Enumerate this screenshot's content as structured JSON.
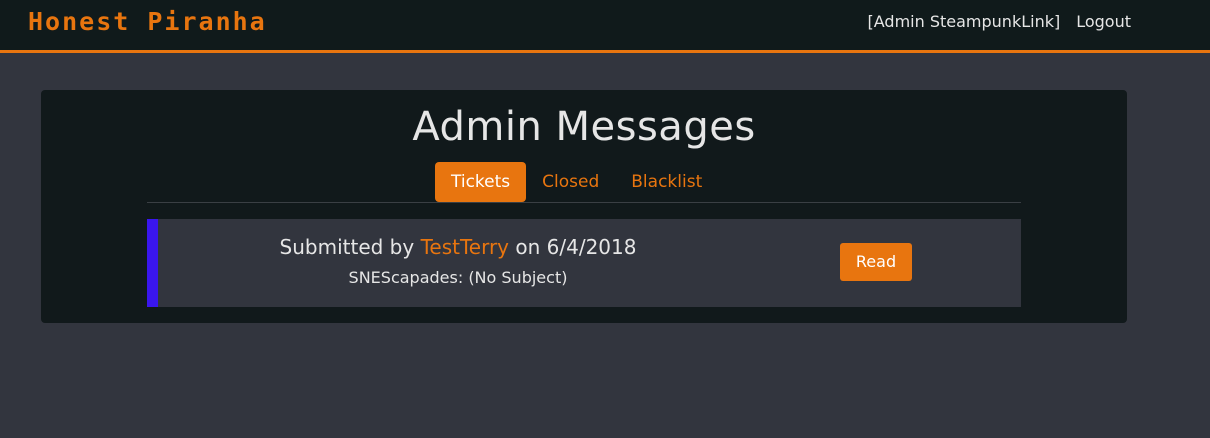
{
  "navbar": {
    "brand": "Honest Piranha",
    "user_label": "[Admin SteampunkLink]",
    "logout_label": "Logout"
  },
  "main": {
    "title": "Admin Messages",
    "tabs": [
      {
        "label": "Tickets",
        "active": true
      },
      {
        "label": "Closed",
        "active": false
      },
      {
        "label": "Blacklist",
        "active": false
      }
    ],
    "tickets": [
      {
        "prefix": "Submitted by",
        "user": "TestTerry",
        "date_text": "on 6/4/2018",
        "subject": "SNEScapades: (No Subject)",
        "action_label": "Read"
      }
    ]
  },
  "colors": {
    "accent": "#e8750f",
    "ticket_border": "#3a16ee",
    "background": "#32353e",
    "panel": "#11191b",
    "navbar": "#101a1b"
  }
}
